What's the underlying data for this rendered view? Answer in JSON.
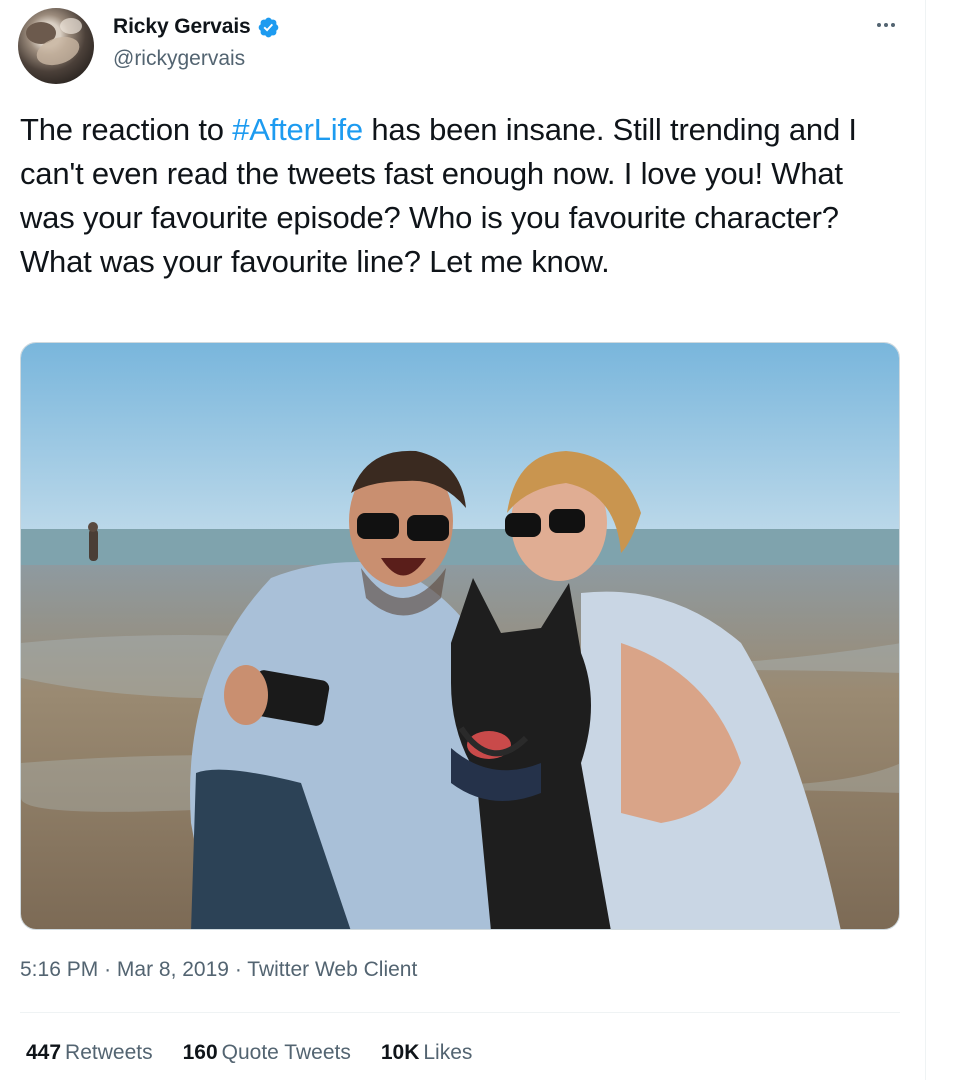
{
  "author": {
    "display_name": "Ricky Gervais",
    "handle": "@rickygervais",
    "verified": true
  },
  "tweet": {
    "text_before": "The reaction to ",
    "hashtag": "#AfterLife",
    "text_after": " has been insane. Still trending and I can't even read the tweets fast enough now. I love you! What was your favourite episode? Who is you favourite character? What was your favourite line? Let me know.",
    "time": "5:16 PM",
    "date": "Mar 8, 2019",
    "client": "Twitter Web Client",
    "separator": "·"
  },
  "stats": {
    "retweets_count": "447",
    "retweets_label": "Retweets",
    "quotes_count": "160",
    "quotes_label": "Quote Tweets",
    "likes_count": "10K",
    "likes_label": "Likes"
  },
  "colors": {
    "accent": "#1d9bf0",
    "secondary_text": "#536471",
    "primary_text": "#0f1419"
  },
  "icons": [
    "verified-badge-icon",
    "more-options-icon"
  ]
}
